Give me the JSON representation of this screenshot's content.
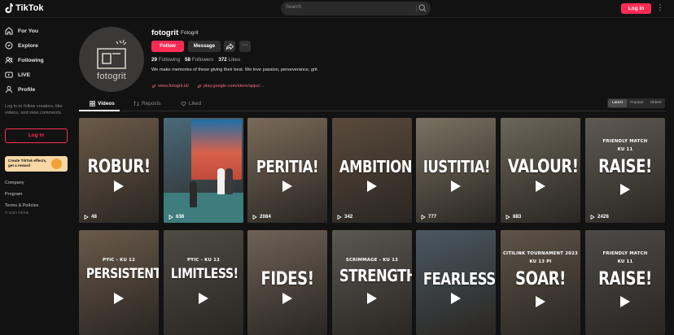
{
  "header": {
    "brand": "TikTok",
    "search_placeholder": "Search",
    "login_label": "Log in",
    "more_label": "⋮"
  },
  "sidebar": {
    "items": [
      {
        "label": "For You",
        "icon": "home-icon"
      },
      {
        "label": "Explore",
        "icon": "compass-icon"
      },
      {
        "label": "Following",
        "icon": "following-icon"
      },
      {
        "label": "LIVE",
        "icon": "live-icon"
      },
      {
        "label": "Profile",
        "icon": "profile-icon"
      }
    ],
    "login_hint": "Log in to follow creators, like videos, and view comments.",
    "login_label": "Log in",
    "effects_text": "Create TikTok effects, get a reward",
    "footer": [
      "Company",
      "Program",
      "Terms & Policies"
    ],
    "copyright": "© 2024 TikTok"
  },
  "profile": {
    "avatar_text": "fotogrit",
    "username": "fotogrit",
    "nickname": "Fotogrit",
    "follow_label": "Follow",
    "message_label": "Message",
    "more_label": "···",
    "following_count": "29",
    "following_label": "Following",
    "followers_count": "58",
    "followers_label": "Followers",
    "likes_count": "372",
    "likes_label": "Likes",
    "bio": "We make memories of those giving their best. We love passion, perseverance, grit",
    "link_1": "www.fotogrit.id/",
    "link_2": "play.google.com/store/apps/..."
  },
  "tabs": {
    "videos": "Videos",
    "reposts": "Reposts",
    "liked": "Liked",
    "sort": [
      "Latest",
      "Popular",
      "Oldest"
    ],
    "sort_active": "Latest"
  },
  "videos": [
    {
      "sub": "",
      "word": "ROBUR!",
      "views": "48",
      "color": "#6b5a48"
    },
    {
      "sub": "",
      "word": "",
      "views": "636",
      "color": "#4a6a7a"
    },
    {
      "sub": "",
      "word": "PERITIA!",
      "views": "2084",
      "color": "#7a6a5a"
    },
    {
      "sub": "",
      "word": "AMBITION!",
      "views": "342",
      "color": "#5a4a3c"
    },
    {
      "sub": "",
      "word": "IUSTITIA!",
      "views": "777",
      "color": "#7a7262"
    },
    {
      "sub": "",
      "word": "VALOUR!",
      "views": "883",
      "color": "#6a6658"
    },
    {
      "sub": "FRIENDLY MATCH\nKU 11",
      "word": "RAISE!",
      "views": "2428",
      "color": "#5e5a52"
    },
    {
      "sub": "PYIC - KU 12",
      "word": "PERSISTENT!",
      "views": "",
      "color": "#6a5a4a"
    },
    {
      "sub": "PYIC - KU 12",
      "word": "LIMITLESS!",
      "views": "",
      "color": "#4e4a44"
    },
    {
      "sub": "",
      "word": "FIDES!",
      "views": "",
      "color": "#6e6256"
    },
    {
      "sub": "SCRIMMAGE - KU 13",
      "word": "STRENGTH!",
      "views": "",
      "color": "#5a5852"
    },
    {
      "sub": "",
      "word": "FEARLESS",
      "views": "",
      "color": "#4a5862"
    },
    {
      "sub": "CITILINK TOURNAMENT 2023\nKU 13 PI",
      "word": "SOAR!",
      "views": "",
      "color": "#5e5448"
    },
    {
      "sub": "FRIENDLY MATCH\nKU 11",
      "word": "RAISE!",
      "views": "",
      "color": "#4c4a48"
    }
  ]
}
